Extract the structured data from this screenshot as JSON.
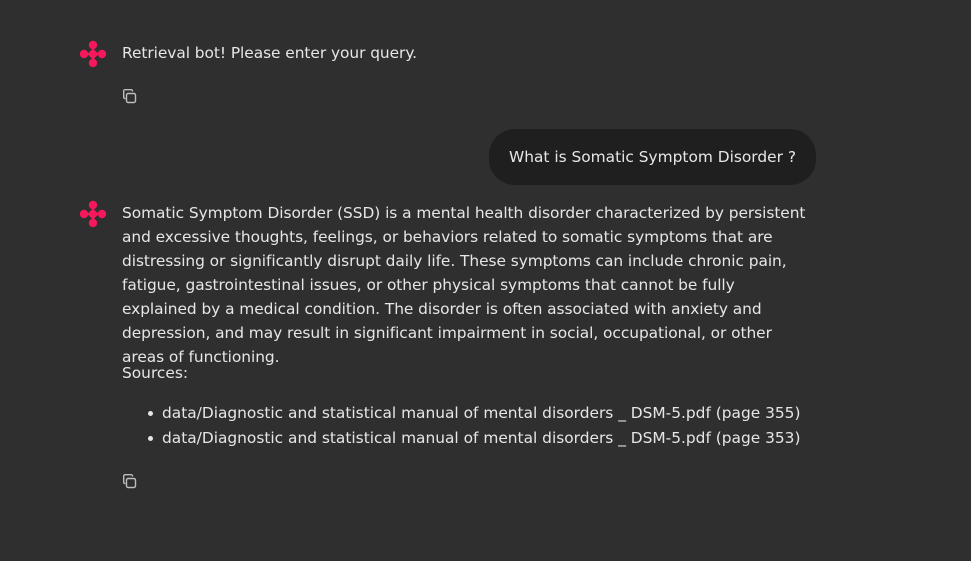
{
  "colors": {
    "background": "#2f2f2f",
    "bubble": "#1f1f1f",
    "text": "#e6e6e6",
    "avatar_accent": "#f5195c",
    "icon": "#bdbdbd"
  },
  "messages": {
    "greeting": {
      "text": "Retrieval bot! Please enter your query."
    },
    "user_query": {
      "text": "What is Somatic Symptom Disorder ?"
    },
    "answer": {
      "text": "Somatic Symptom Disorder (SSD) is a mental health disorder characterized by persistent and excessive thoughts, feelings, or behaviors related to somatic symptoms that are distressing or significantly disrupt daily life. These symptoms can include chronic pain, fatigue, gastrointestinal issues, or other physical symptoms that cannot be fully explained by a medical condition. The disorder is often associated with anxiety and depression, and may result in significant impairment in social, occupational, or other areas of functioning.",
      "sources_label": "Sources:",
      "sources": [
        "data/Diagnostic and statistical manual of mental disorders _ DSM-5.pdf (page 355)",
        "data/Diagnostic and statistical manual of mental disorders _ DSM-5.pdf (page 353)"
      ]
    }
  },
  "icons": {
    "avatar": "bot-avatar-icon",
    "copy": "copy-icon"
  }
}
